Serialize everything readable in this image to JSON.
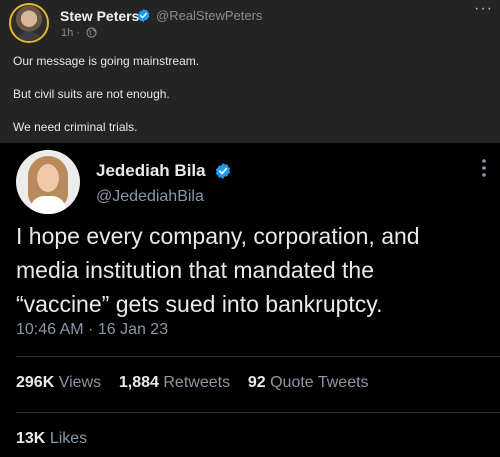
{
  "outer_post": {
    "author_name": "Stew Peters",
    "handle": "@RealStewPeters",
    "time": "1h",
    "separator": "·",
    "more_label": "···",
    "lines": [
      "Our message is going mainstream.",
      "But civil suits are not enough.",
      "We need criminal trials."
    ]
  },
  "quoted_tweet": {
    "author_name": "Jedediah Bila",
    "handle": "@JedediahBila",
    "text_lines": [
      "I hope every company, corporation, and",
      "media institution that mandated the",
      "“vaccine” gets sued into bankruptcy."
    ],
    "timestamp": "10:46 AM · 16 Jan 23",
    "views_count": "296K",
    "views_label": "Views",
    "retweets_count": "1,884",
    "retweets_label": "Retweets",
    "quotes_count": "92",
    "quotes_label": "Quote Tweets",
    "likes_count": "13K",
    "likes_label": "Likes"
  },
  "colors": {
    "verified_blue": "#1d9bf0",
    "avatar_ring": "#e2b629",
    "outer_background": "#242424",
    "inner_background": "#000000"
  },
  "icons": [
    "verified-badge-icon",
    "globe-icon",
    "more-options-icon"
  ]
}
